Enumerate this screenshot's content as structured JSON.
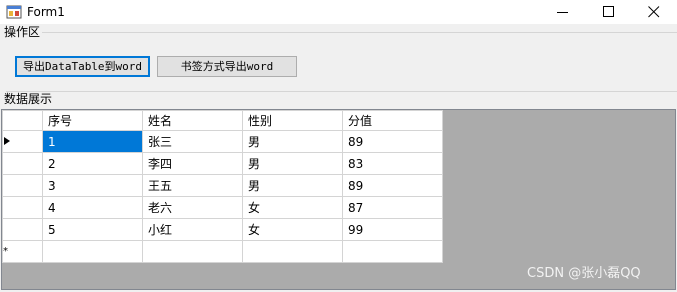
{
  "window": {
    "title": "Form1"
  },
  "operations": {
    "label": "操作区",
    "export_datatable_button": "导出DataTable到word",
    "export_bookmark_button": "书签方式导出word"
  },
  "display": {
    "label": "数据展示"
  },
  "grid": {
    "columns": [
      "序号",
      "姓名",
      "性别",
      "分值"
    ],
    "rows": [
      [
        "1",
        "张三",
        "男",
        "89"
      ],
      [
        "2",
        "李四",
        "男",
        "83"
      ],
      [
        "3",
        "王五",
        "男",
        "89"
      ],
      [
        "4",
        "老六",
        "女",
        "87"
      ],
      [
        "5",
        "小红",
        "女",
        "99"
      ]
    ],
    "new_row_marker": "*"
  },
  "watermark": "CSDN @张小磊QQ",
  "colors": {
    "selection": "#0078d7",
    "grid_background": "#ababab"
  }
}
